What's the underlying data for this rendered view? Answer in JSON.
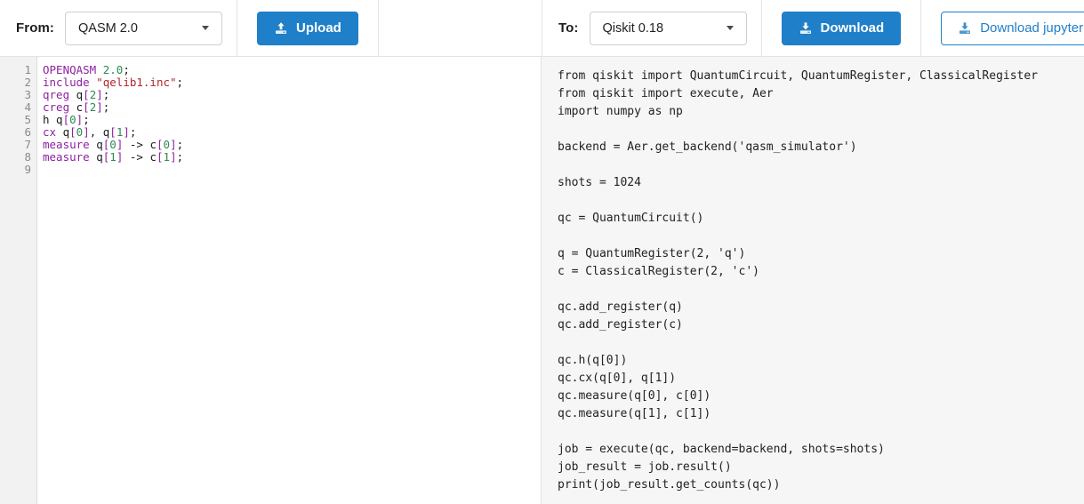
{
  "toolbar": {
    "from": {
      "label": "From:",
      "select_value": "QASM 2.0",
      "caret_icon": "chevron-down-icon"
    },
    "upload_button": {
      "label": "Upload",
      "icon": "upload-icon"
    },
    "to": {
      "label": "To:",
      "select_value": "Qiskit 0.18",
      "caret_icon": "chevron-down-icon"
    },
    "download_button": {
      "label": "Download",
      "icon": "download-icon"
    },
    "download_jupyter_button": {
      "label": "Download jupyter",
      "icon": "download-icon"
    }
  },
  "colors": {
    "accent": "#1f7fc9",
    "keyword": "#8f1fa3",
    "number": "#2e8b4e",
    "string": "#b3242b",
    "gutter_bg": "#f2f2f2",
    "right_pane_bg": "#f6f6f6"
  },
  "source_editor": {
    "line_numbers": [
      "1",
      "2",
      "3",
      "4",
      "5",
      "6",
      "7",
      "8",
      "9"
    ],
    "lines": [
      [
        {
          "t": "OPENQASM",
          "c": "kw"
        },
        {
          "t": " ",
          "c": "plain"
        },
        {
          "t": "2.0",
          "c": "num"
        },
        {
          "t": ";",
          "c": "plain"
        }
      ],
      [
        {
          "t": "include",
          "c": "kw"
        },
        {
          "t": " ",
          "c": "plain"
        },
        {
          "t": "\"qelib1.inc\"",
          "c": "str"
        },
        {
          "t": ";",
          "c": "plain"
        }
      ],
      [
        {
          "t": "qreg",
          "c": "kw"
        },
        {
          "t": " q",
          "c": "plain"
        },
        {
          "t": "[",
          "c": "brk"
        },
        {
          "t": "2",
          "c": "num"
        },
        {
          "t": "]",
          "c": "brk"
        },
        {
          "t": ";",
          "c": "plain"
        }
      ],
      [
        {
          "t": "creg",
          "c": "kw"
        },
        {
          "t": " c",
          "c": "plain"
        },
        {
          "t": "[",
          "c": "brk"
        },
        {
          "t": "2",
          "c": "num"
        },
        {
          "t": "]",
          "c": "brk"
        },
        {
          "t": ";",
          "c": "plain"
        }
      ],
      [
        {
          "t": "h",
          "c": "plain"
        },
        {
          "t": " q",
          "c": "plain"
        },
        {
          "t": "[",
          "c": "brk"
        },
        {
          "t": "0",
          "c": "num"
        },
        {
          "t": "]",
          "c": "brk"
        },
        {
          "t": ";",
          "c": "plain"
        }
      ],
      [
        {
          "t": "cx",
          "c": "kw"
        },
        {
          "t": " q",
          "c": "plain"
        },
        {
          "t": "[",
          "c": "brk"
        },
        {
          "t": "0",
          "c": "num"
        },
        {
          "t": "]",
          "c": "brk"
        },
        {
          "t": ", q",
          "c": "plain"
        },
        {
          "t": "[",
          "c": "brk"
        },
        {
          "t": "1",
          "c": "num"
        },
        {
          "t": "]",
          "c": "brk"
        },
        {
          "t": ";",
          "c": "plain"
        }
      ],
      [
        {
          "t": "measure",
          "c": "kw"
        },
        {
          "t": " q",
          "c": "plain"
        },
        {
          "t": "[",
          "c": "brk"
        },
        {
          "t": "0",
          "c": "num"
        },
        {
          "t": "]",
          "c": "brk"
        },
        {
          "t": " ",
          "c": "plain"
        },
        {
          "t": "->",
          "c": "op"
        },
        {
          "t": " c",
          "c": "plain"
        },
        {
          "t": "[",
          "c": "brk"
        },
        {
          "t": "0",
          "c": "num"
        },
        {
          "t": "]",
          "c": "brk"
        },
        {
          "t": ";",
          "c": "plain"
        }
      ],
      [
        {
          "t": "measure",
          "c": "kw"
        },
        {
          "t": " q",
          "c": "plain"
        },
        {
          "t": "[",
          "c": "brk"
        },
        {
          "t": "1",
          "c": "num"
        },
        {
          "t": "]",
          "c": "brk"
        },
        {
          "t": " ",
          "c": "plain"
        },
        {
          "t": "->",
          "c": "op"
        },
        {
          "t": " c",
          "c": "plain"
        },
        {
          "t": "[",
          "c": "brk"
        },
        {
          "t": "1",
          "c": "num"
        },
        {
          "t": "]",
          "c": "brk"
        },
        {
          "t": ";",
          "c": "plain"
        }
      ],
      []
    ],
    "plain_text": "OPENQASM 2.0;\ninclude \"qelib1.inc\";\nqreg q[2];\ncreg c[2];\nh q[0];\ncx q[0], q[1];\nmeasure q[0] -> c[0];\nmeasure q[1] -> c[1];\n"
  },
  "output_code": {
    "lines": [
      "from qiskit import QuantumCircuit, QuantumRegister, ClassicalRegister",
      "from qiskit import execute, Aer",
      "import numpy as np",
      "",
      "backend = Aer.get_backend('qasm_simulator')",
      "",
      "shots = 1024",
      "",
      "qc = QuantumCircuit()",
      "",
      "q = QuantumRegister(2, 'q')",
      "c = ClassicalRegister(2, 'c')",
      "",
      "qc.add_register(q)",
      "qc.add_register(c)",
      "",
      "qc.h(q[0])",
      "qc.cx(q[0], q[1])",
      "qc.measure(q[0], c[0])",
      "qc.measure(q[1], c[1])",
      "",
      "job = execute(qc, backend=backend, shots=shots)",
      "job_result = job.result()",
      "print(job_result.get_counts(qc))"
    ]
  }
}
